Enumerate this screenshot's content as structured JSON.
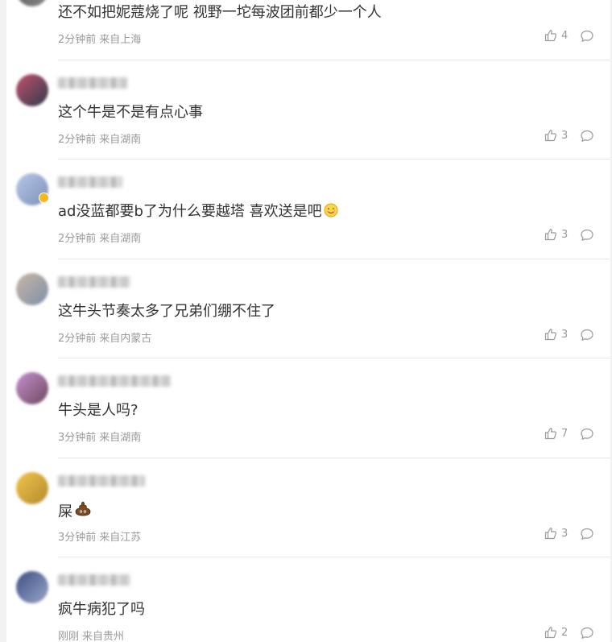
{
  "comments": [
    {
      "text": "还不如把妮蔻烧了呢 视野一坨每波团前都少一个人",
      "time": "2分钟前",
      "location": "来自上海",
      "likes": "4",
      "avatar_colors": [
        "#555555",
        "#888888"
      ]
    },
    {
      "text": "这个牛是不是有点心事",
      "time": "2分钟前",
      "location": "来自湖南",
      "likes": "3",
      "avatar_colors": [
        "#c2516b",
        "#2f3c4e"
      ]
    },
    {
      "text": "ad没蓝都要b了为什么要越塔 喜欢送是吧",
      "emoji": "smile-emoji",
      "time": "2分钟前",
      "location": "来自湖南",
      "likes": "3",
      "avatar_colors": [
        "#b7c9e8",
        "#7d8fb6"
      ],
      "badge": true
    },
    {
      "text": "这牛头节奏太多了兄弟们绷不住了",
      "time": "2分钟前",
      "location": "来自内蒙古",
      "likes": "3",
      "avatar_colors": [
        "#c8b7a6",
        "#7f8fa8"
      ]
    },
    {
      "text": "牛头是人吗?",
      "time": "3分钟前",
      "location": "来自湖南",
      "likes": "7",
      "avatar_colors": [
        "#c58fcf",
        "#6e4a5f"
      ]
    },
    {
      "text": "屎",
      "emoji": "poop-emoji",
      "time": "3分钟前",
      "location": "来自江苏",
      "likes": "3",
      "avatar_colors": [
        "#f1c54d",
        "#b48a2c"
      ]
    },
    {
      "text": "疯牛病犯了吗",
      "time": "刚刚",
      "location": "来自贵州",
      "likes": "2",
      "avatar_colors": [
        "#3b4f82",
        "#9aa6c8"
      ]
    }
  ]
}
